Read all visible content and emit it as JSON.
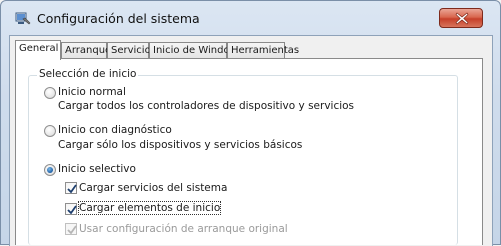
{
  "window": {
    "title": "Configuración del sistema",
    "icon": "system-config-icon",
    "close_icon": "close-icon"
  },
  "tabs": [
    {
      "label": "General",
      "active": true
    },
    {
      "label": "Arranque",
      "active": false
    },
    {
      "label": "Servicios",
      "active": false
    },
    {
      "label": "Inicio de Windows",
      "active": false
    },
    {
      "label": "Herramientas",
      "active": false
    }
  ],
  "startup_selection": {
    "group_label": "Selección de inicio",
    "options": [
      {
        "label": "Inicio normal",
        "description": "Cargar todos los controladores de dispositivo y servicios",
        "selected": false
      },
      {
        "label": "Inicio con diagnóstico",
        "description": "Cargar sólo los dispositivos y servicios básicos",
        "selected": false
      },
      {
        "label": "Inicio selectivo",
        "selected": true
      }
    ],
    "checkboxes": [
      {
        "label": "Cargar servicios del sistema",
        "checked": true,
        "enabled": true
      },
      {
        "label": "Cargar elementos de inicio",
        "checked": true,
        "enabled": true
      },
      {
        "label": "Usar configuración de arranque original",
        "checked": true,
        "enabled": false
      }
    ]
  },
  "colors": {
    "accent": "#1d5ea4",
    "close_button": "#c6402a"
  }
}
